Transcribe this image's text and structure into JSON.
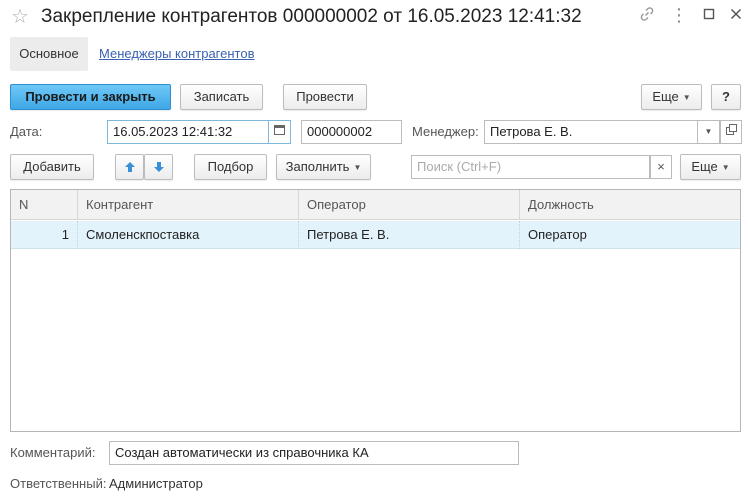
{
  "window": {
    "title": "Закрепление контрагентов 000000002 от 16.05.2023 12:41:32"
  },
  "tabs": [
    {
      "label": "Основное"
    },
    {
      "label": "Менеджеры контрагентов"
    }
  ],
  "toolbar": {
    "post_close": "Провести и закрыть",
    "save": "Записать",
    "post": "Провести",
    "more": "Еще",
    "help": "?"
  },
  "form": {
    "date_label": "Дата:",
    "date_value": "16.05.2023 12:41:32",
    "number_value": "000000002",
    "manager_label": "Менеджер:",
    "manager_value": "Петрова Е. В."
  },
  "table_toolbar": {
    "add": "Добавить",
    "select": "Подбор",
    "fill": "Заполнить",
    "search_placeholder": "Поиск (Ctrl+F)",
    "more": "Еще"
  },
  "table": {
    "columns": [
      "N",
      "Контрагент",
      "Оператор",
      "Должность"
    ],
    "rows": [
      {
        "n": "1",
        "counterparty": "Смоленскпоставка",
        "operator": "Петрова Е. В.",
        "position": "Оператор"
      }
    ]
  },
  "footer": {
    "comment_label": "Комментарий:",
    "comment_value": "Создан автоматически из справочника КА",
    "responsible_label": "Ответственный:",
    "responsible_value": "Администратор"
  }
}
